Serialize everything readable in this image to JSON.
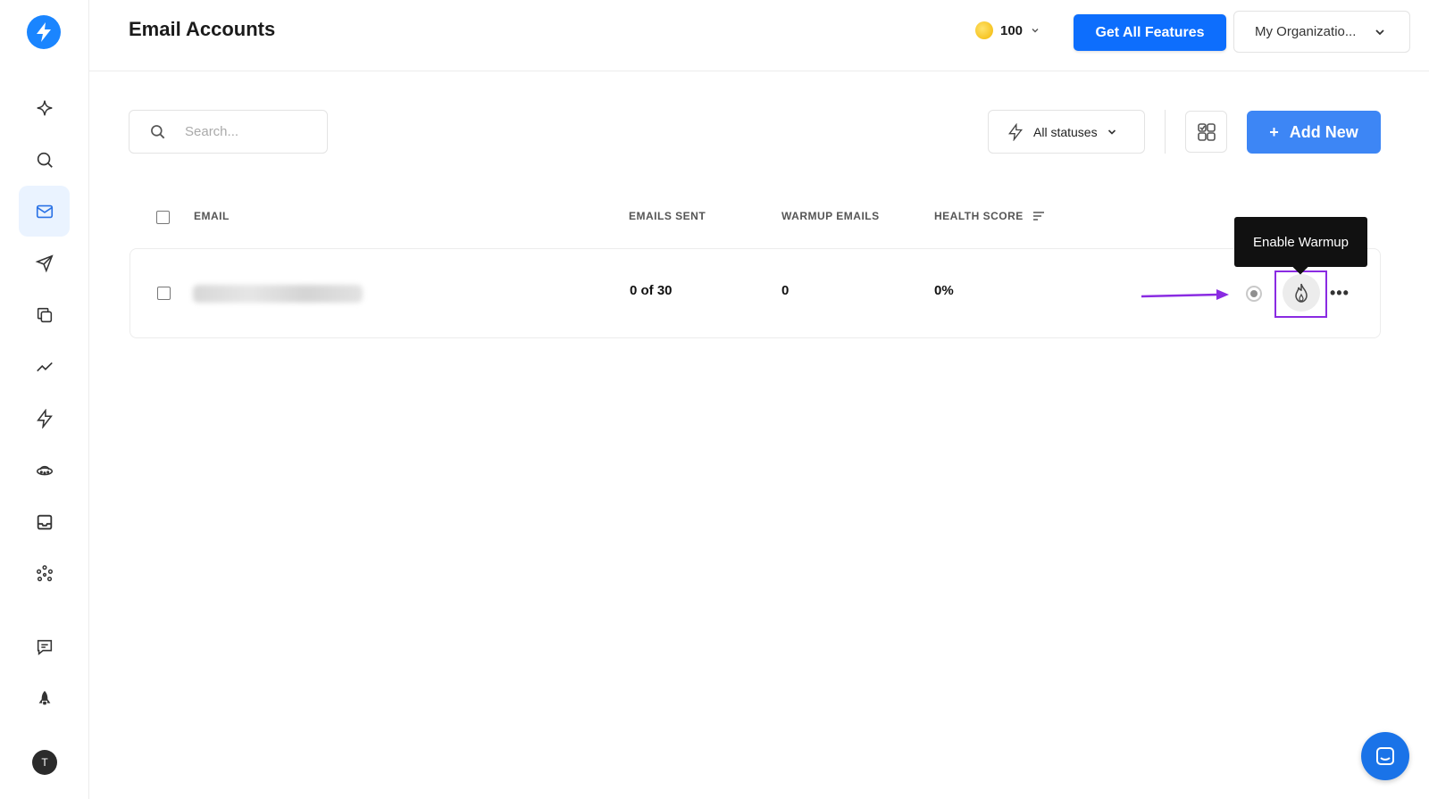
{
  "header": {
    "title": "Email Accounts",
    "credits": "100",
    "get_features_label": "Get All Features",
    "org_label": "My Organizatio..."
  },
  "toolbar": {
    "search_placeholder": "Search...",
    "status_filter_label": "All statuses",
    "add_new_label": "Add New"
  },
  "table": {
    "columns": [
      "EMAIL",
      "EMAILS SENT",
      "WARMUP EMAILS",
      "HEALTH SCORE"
    ],
    "rows": [
      {
        "email": "",
        "emails_sent": "0  of  30",
        "warmup_emails": "0",
        "health_score": "0%"
      }
    ]
  },
  "tooltip": {
    "text": "Enable Warmup"
  },
  "sidebar": {
    "avatar_initial": "T",
    "items": [
      "sparkle-icon",
      "search-icon",
      "mail-icon",
      "send-icon",
      "copy-icon",
      "analytics-icon",
      "bolt-icon",
      "ufo-icon",
      "inbox-icon",
      "integrations-icon",
      "feedback-icon",
      "rocket-icon"
    ]
  },
  "colors": {
    "primary": "#0d6efd",
    "add_new": "#3d86f5",
    "highlight": "#8a2be2"
  }
}
